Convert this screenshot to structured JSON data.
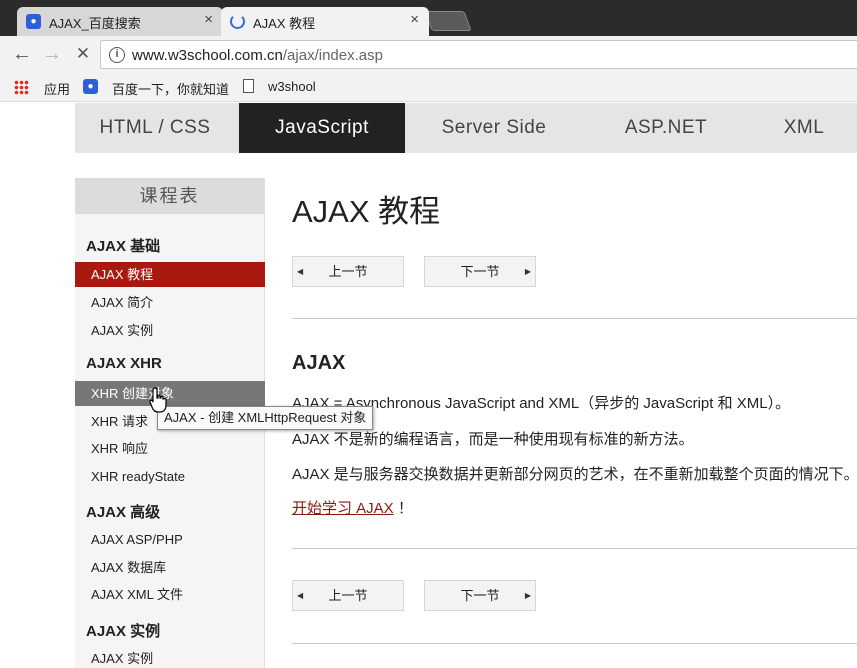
{
  "browser": {
    "tabs": [
      {
        "title": "AJAX_百度搜索",
        "icon": "baidu-paw-icon",
        "active": false
      },
      {
        "title": "AJAX 教程",
        "icon": "loading-spinner-icon",
        "active": true
      }
    ],
    "tab_close_glyph": "×",
    "url": {
      "host": "www.w3school.com.cn",
      "path": "/ajax/index.asp"
    },
    "nav": {
      "back": "←",
      "forward": "→",
      "stop": "✕",
      "info": "i"
    },
    "bookmarks": [
      {
        "label": "应用",
        "icon": "apps-grid-icon"
      },
      {
        "label": "百度一下，你就知道",
        "icon": "baidu-paw-icon"
      },
      {
        "label": "w3shool",
        "icon": "page-icon"
      }
    ]
  },
  "topnav": {
    "items": [
      "HTML / CSS",
      "JavaScript",
      "Server Side",
      "ASP.NET",
      "XML"
    ],
    "active_index": 1
  },
  "sidebar": {
    "title": "课程表",
    "groups": [
      {
        "title": "AJAX 基础",
        "items": [
          "AJAX 教程",
          "AJAX 简介",
          "AJAX 实例"
        ]
      },
      {
        "title": "AJAX XHR",
        "items": [
          "XHR 创建对象",
          "XHR 请求",
          "XHR 响应",
          "XHR readyState"
        ]
      },
      {
        "title": "AJAX 高级",
        "items": [
          "AJAX ASP/PHP",
          "AJAX 数据库",
          "AJAX XML 文件"
        ]
      },
      {
        "title": "AJAX 实例",
        "items": [
          "AJAX 实例"
        ]
      }
    ],
    "selected_item": "AJAX 教程",
    "hovered_item": "XHR 创建对象",
    "tooltip": "AJAX - 创建 XMLHttpRequest 对象"
  },
  "main": {
    "title": "AJAX 教程",
    "prev_label": "上一节",
    "next_label": "下一节",
    "prev_arrow": "◀",
    "next_arrow": "▶",
    "section_title": "AJAX",
    "paragraphs": [
      "AJAX = Asynchronous JavaScript and XML（异步的 JavaScript 和 XML）。",
      "AJAX 不是新的编程语言，而是一种使用现有标准的新方法。",
      "AJAX 是与服务器交换数据并更新部分网页的艺术，在不重新加载整个页面的情况下。"
    ],
    "start_link": "开始学习 AJAX",
    "start_suffix": "！"
  },
  "colors": {
    "accent_red": "#a9190f",
    "nav_active": "#222222",
    "link": "#8a1a12"
  }
}
